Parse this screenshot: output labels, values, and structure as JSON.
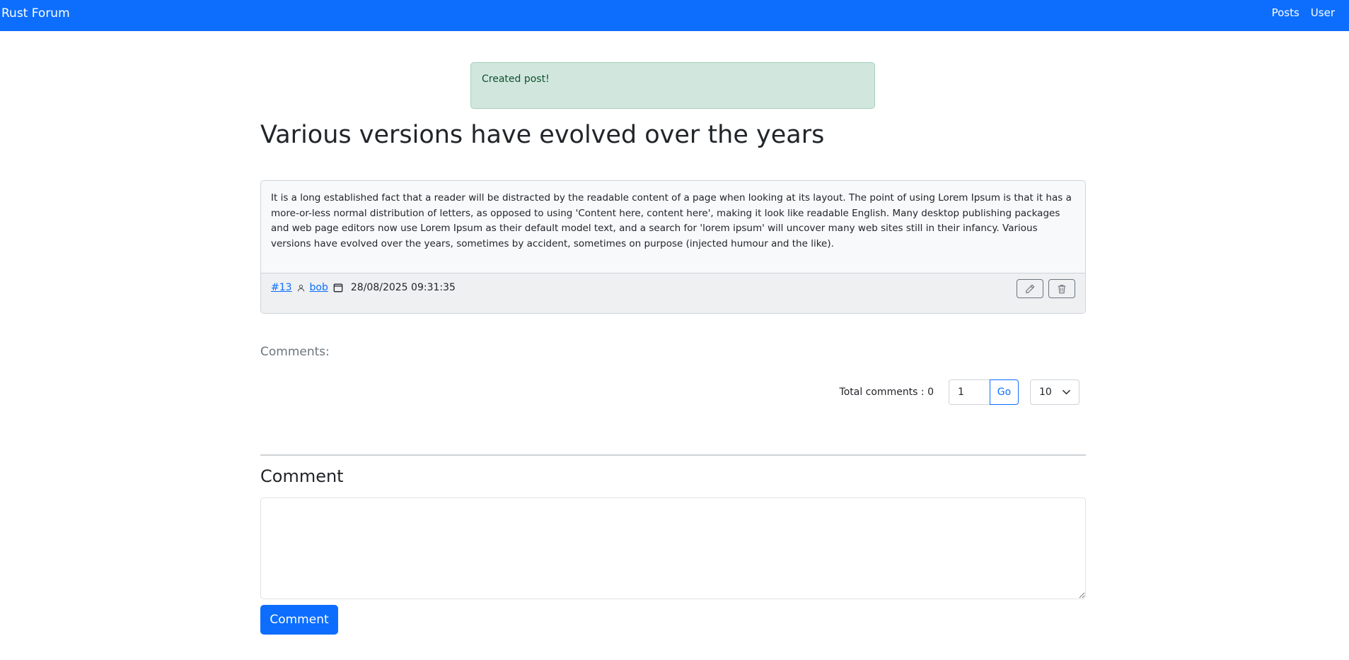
{
  "navbar": {
    "brand": "Rust Forum",
    "links": [
      "Posts",
      "User"
    ]
  },
  "alert": {
    "message": "Created post!"
  },
  "post": {
    "title": "Various versions have evolved over the years",
    "body": "It is a long established fact that a reader will be distracted by the readable content of a page when looking at its layout. The point of using Lorem Ipsum is that it has a more-or-less normal distribution of letters, as opposed to using 'Content here, content here', making it look like readable English. Many desktop publishing packages and web page editors now use Lorem Ipsum as their default model text, and a search for 'lorem ipsum' will uncover many web sites still in their infancy. Various versions have evolved over the years, sometimes by accident, sometimes on purpose (injected humour and the like).",
    "id": "#13",
    "author": "bob",
    "date": "28/08/2025 09:31:35",
    "icons": {
      "author": "person-icon",
      "date": "calendar-icon",
      "edit": "pencil-icon",
      "delete": "trash-icon"
    }
  },
  "comments": {
    "label": "Comments:",
    "total_text": "Total comments : 0",
    "page_value": "1",
    "go_label": "Go",
    "per_page": "10"
  },
  "comment_form": {
    "heading": "Comment",
    "textarea_value": "",
    "submit_label": "Comment"
  },
  "colors": {
    "primary": "#0d6efd",
    "alert_bg": "#d1e7dd",
    "alert_text": "#0f5132"
  }
}
